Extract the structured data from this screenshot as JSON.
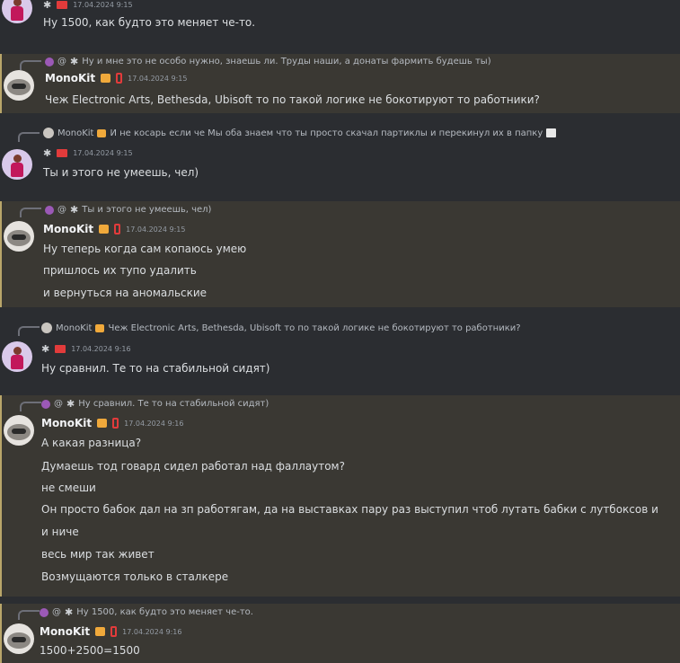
{
  "messages": [
    {
      "id": "m1",
      "timestamp": "17.04.2024 9:15",
      "lines": [
        "Ну 1500, как будто это меняет че-то."
      ]
    },
    {
      "id": "m2",
      "reply": {
        "prefix": "@",
        "text": "Ну и мне это не особо нужно, знаешь ли. Труды наши, а донаты фармить будешь ты)"
      },
      "author": "MonoKit",
      "timestamp": "17.04.2024 9:15",
      "lines": [
        "Чеж Electronic Arts, Bethesda, Ubisoft то по такой логике не бокотируют то работники?"
      ]
    },
    {
      "id": "m3",
      "reply": {
        "author": "MonoKit",
        "text": "И не косарь если че  Мы оба знаем что ты просто скачал партиклы и перекинул их в папку"
      },
      "timestamp": "17.04.2024 9:15",
      "lines": [
        "Ты и этого не умеешь, чел)"
      ]
    },
    {
      "id": "m4",
      "reply": {
        "prefix": "@",
        "text": "Ты и этого не умеешь, чел)"
      },
      "author": "MonoKit",
      "timestamp": "17.04.2024 9:15",
      "lines": [
        "Ну теперь когда сам копаюсь умею",
        "пришлось их тупо удалить",
        "и вернуться на аномальские"
      ]
    },
    {
      "id": "m5",
      "reply": {
        "author": "MonoKit",
        "text": "Чеж Electronic Arts, Bethesda, Ubisoft то по такой логике не бокотируют то работники?"
      },
      "timestamp": "17.04.2024 9:16",
      "lines": [
        "Ну сравнил. Те то на стабильной сидят)"
      ]
    },
    {
      "id": "m6",
      "reply": {
        "prefix": "@",
        "text": "Ну сравнил. Те то на стабильной сидят)"
      },
      "author": "MonoKit",
      "timestamp": "17.04.2024 9:16",
      "lines": [
        "А какая разница?",
        "Думаешь тод говард сидел работал над фаллаутом?",
        "не смеши",
        "Он просто бабок дал на зп работягам, да на выставках пару раз выступил чтоб лутать бабки с лутбоксов и",
        "и ниче",
        "весь мир так живет",
        "Возмущаются только в сталкере"
      ]
    },
    {
      "id": "m7",
      "reply": {
        "prefix": "@",
        "text": "Ну 1500, как будто это меняет че-то."
      },
      "author": "MonoKit",
      "timestamp": "17.04.2024 9:16",
      "lines": [
        "1500+2500=1500"
      ]
    }
  ]
}
